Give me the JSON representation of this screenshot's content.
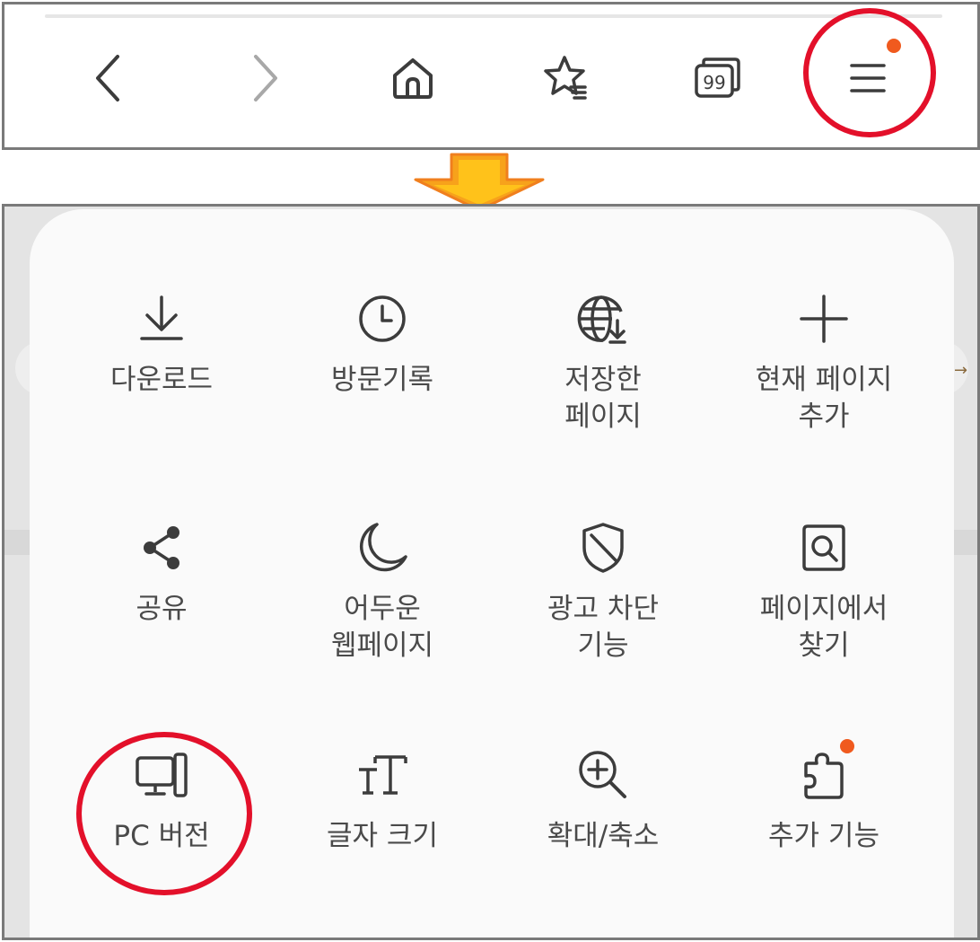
{
  "toolbar": {
    "back_label": "",
    "forward_label": "",
    "tabs_count": "99"
  },
  "menu": {
    "items": [
      {
        "label": "다운로드",
        "icon": "download-icon"
      },
      {
        "label": "방문기록",
        "icon": "history-clock-icon"
      },
      {
        "label": "저장한\n페이지",
        "icon": "saved-pages-globe-icon"
      },
      {
        "label": "현재 페이지\n추가",
        "icon": "plus-icon"
      },
      {
        "label": "공유",
        "icon": "share-icon"
      },
      {
        "label": "어두운\n웹페이지",
        "icon": "moon-icon"
      },
      {
        "label": "광고 차단\n기능",
        "icon": "shield-icon"
      },
      {
        "label": "페이지에서\n찾기",
        "icon": "find-in-page-icon"
      },
      {
        "label": "PC 버전",
        "icon": "desktop-icon"
      },
      {
        "label": "글자 크기",
        "icon": "text-size-icon"
      },
      {
        "label": "확대/축소",
        "icon": "zoom-in-icon"
      },
      {
        "label": "추가 기능",
        "icon": "puzzle-icon"
      }
    ]
  },
  "colors": {
    "accent_dot": "#f05a1e",
    "annotation_red": "#e3102a",
    "arrow_orange": "#f7a21b",
    "icon_grey": "#4a4a4a"
  }
}
